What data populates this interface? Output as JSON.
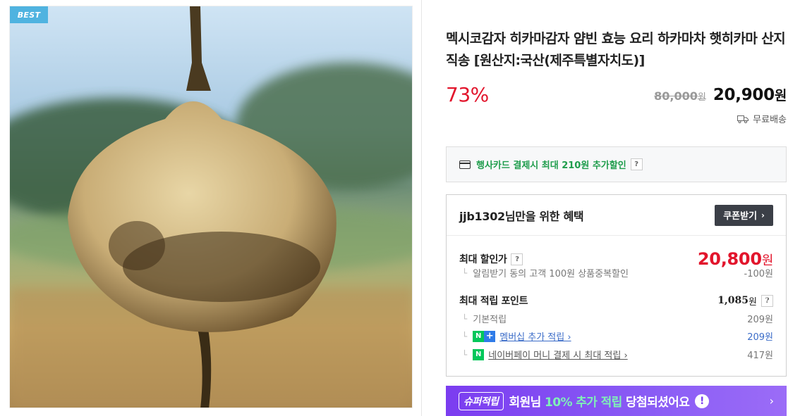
{
  "product": {
    "badge": "BEST",
    "title": "멕시코감자 히카마감자 얌빈 효능 요리 하카마차 햇히카마 산지직송 [원산지:국산(제주특별자치도)]",
    "discount_rate": "73%",
    "original_price": "80,000",
    "original_price_unit": "원",
    "sale_price": "20,900",
    "sale_price_unit": "원",
    "shipping": "무료배송"
  },
  "card_promo": {
    "text": "행사카드 결제시 최대 210원 추가할인",
    "help": "?"
  },
  "benefits": {
    "title": "jjb1302님만을 위한 혜택",
    "coupon_button": "쿠폰받기",
    "coupon_arrow": "›",
    "max_discount": {
      "label": "최대 할인가",
      "help": "?",
      "price": "20,800",
      "unit": "원",
      "sub_label": "알림받기 동의 고객 100원 상품중복할인",
      "sub_value": "-100원"
    },
    "max_points": {
      "label": "최대 적립 포인트",
      "value": "1,085",
      "unit": "원",
      "help": "?",
      "items": [
        {
          "label": "기본적립",
          "value": "209원"
        },
        {
          "label": "멤버십 추가 적립 ›",
          "value": "209원",
          "badge_left": "N",
          "badge_right": "+"
        },
        {
          "label": "네이버페이 머니 결제 시 최대 적립 ›",
          "value": "417원",
          "badge_left": "N"
        }
      ]
    }
  },
  "super_banner": {
    "tag": "슈퍼적립",
    "text_prefix": "회원님 ",
    "text_highlight": "10% 추가 적립",
    "text_suffix": " 당첨되셨어요",
    "excl": "!",
    "chevron": "›"
  },
  "colors": {
    "discount_red": "#e2152c",
    "naver_green": "#03c75a",
    "banner_purple": "#7b3df0"
  }
}
